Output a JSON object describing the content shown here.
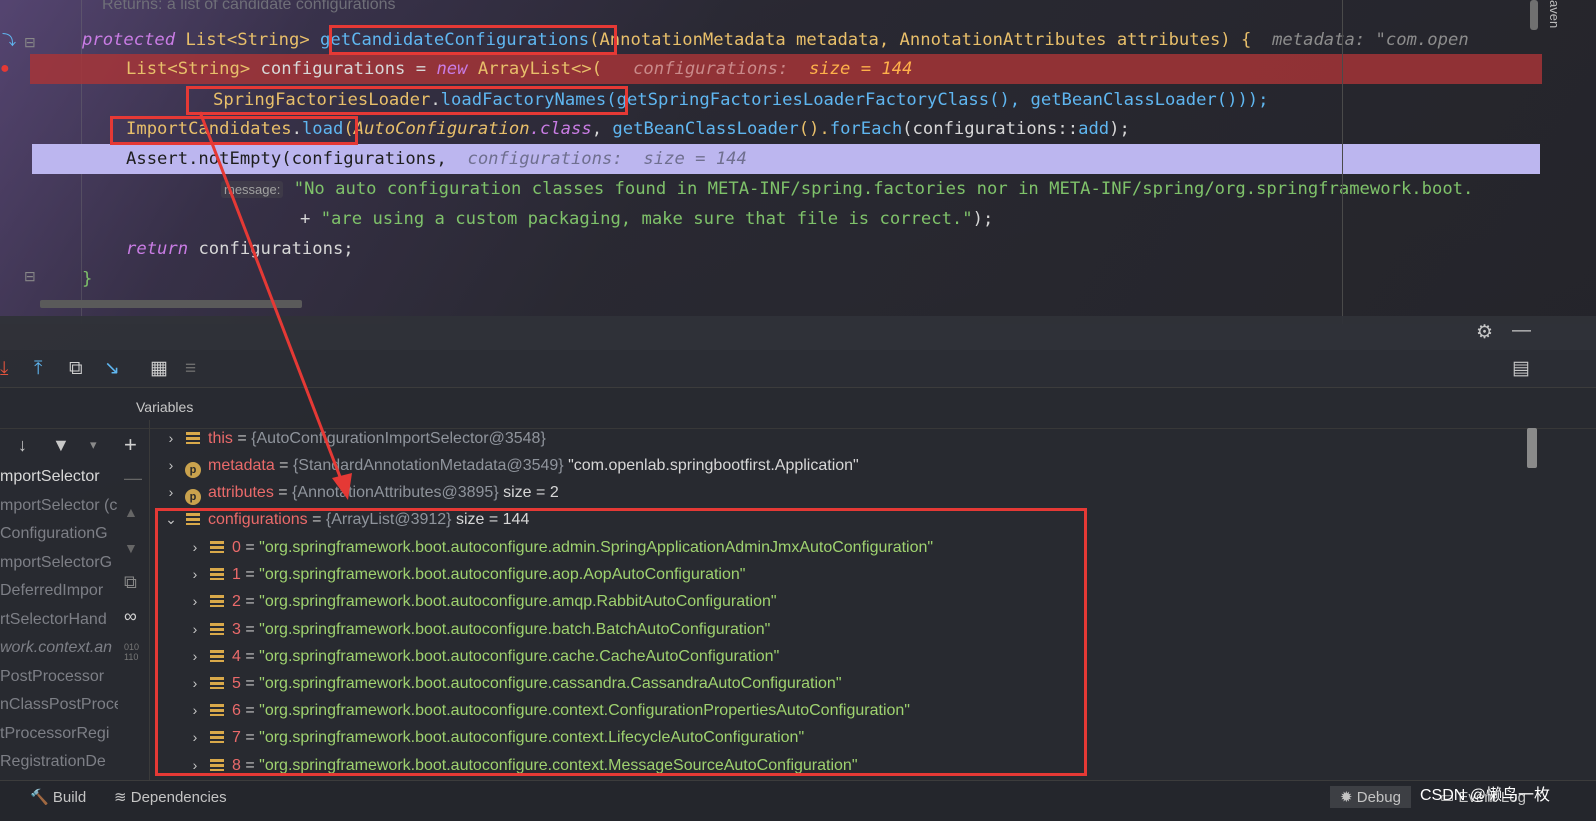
{
  "editor": {
    "doc_comment": "Returns: a list of candidate configurations",
    "lines": [
      {
        "kw": "protected",
        "type": "List<String>",
        "method": "getCandidateConfigurations",
        "params": "(AnnotationMetadata metadata, AnnotationAttributes attributes) {",
        "hint": "metadata: \"com.open"
      },
      {
        "type": "List<String>",
        "name": " configurations = ",
        "kw": "new",
        "ctor": " ArrayList<>(",
        "hint_label": "configurations:",
        "hint_value": "size = 144"
      },
      {
        "cls": "SpringFactoriesLoader",
        "dot": ".",
        "method": "loadFactoryNames",
        "args_a": "(getSpringFactoriesLoaderFactoryClass(), getBeanClassLoader()));"
      },
      {
        "cls": "ImportCandidates",
        "dot": ".",
        "method": "load",
        "open": "(",
        "arg_cls": "AutoConfiguration",
        "arg_kw": ".class",
        "mid": ", ",
        "getcl": "getBeanClassLoader",
        "tail1": "().",
        "foreach": "forEach",
        "tail2": "(configurations::",
        "add": "add",
        "tail3": ");"
      },
      {
        "code": "Assert.notEmpty(configurations,",
        "hint": "configurations:  size = 144"
      },
      {
        "param": "message:",
        "str": "\"No auto configuration classes found in META-INF/spring.factories nor in META-INF/spring/org.springframework.boot."
      },
      {
        "plus": "+ ",
        "str": "\"are using a custom packaging, make sure that file is correct.\"",
        "end": ");"
      },
      {
        "kw": "return",
        "rest": " configurations;"
      },
      {
        "brace": "}"
      }
    ],
    "side_label": "aven"
  },
  "debugger": {
    "variables_title": "Variables",
    "frames": [
      "mportSelector",
      "mportSelector (c",
      "ConfigurationG",
      "mportSelectorG",
      "DeferredImpor",
      "rtSelectorHand",
      "work.context.an",
      "PostProcessor",
      "nClassPostProce",
      "tProcessorRegi",
      "RegistrationDe"
    ],
    "variables": [
      {
        "name": "this",
        "type": "{AutoConfigurationImportSelector@3548}",
        "extra": "",
        "icon": "field-icon"
      },
      {
        "name": "metadata",
        "type": "{StandardAnnotationMetadata@3549}",
        "extra": "\"com.openlab.springbootfirst.Application\"",
        "icon": "param-icon"
      },
      {
        "name": "attributes",
        "type": "{AnnotationAttributes@3895}",
        "extra": "size = 2",
        "icon": "param-icon"
      },
      {
        "name": "configurations",
        "type": "{ArrayList@3912}",
        "extra": "size = 144",
        "icon": "field-icon"
      }
    ],
    "items": [
      {
        "index": "0",
        "value": "\"org.springframework.boot.autoconfigure.admin.SpringApplicationAdminJmxAutoConfiguration\""
      },
      {
        "index": "1",
        "value": "\"org.springframework.boot.autoconfigure.aop.AopAutoConfiguration\""
      },
      {
        "index": "2",
        "value": "\"org.springframework.boot.autoconfigure.amqp.RabbitAutoConfiguration\""
      },
      {
        "index": "3",
        "value": "\"org.springframework.boot.autoconfigure.batch.BatchAutoConfiguration\""
      },
      {
        "index": "4",
        "value": "\"org.springframework.boot.autoconfigure.cache.CacheAutoConfiguration\""
      },
      {
        "index": "5",
        "value": "\"org.springframework.boot.autoconfigure.cassandra.CassandraAutoConfiguration\""
      },
      {
        "index": "6",
        "value": "\"org.springframework.boot.autoconfigure.context.ConfigurationPropertiesAutoConfiguration\""
      },
      {
        "index": "7",
        "value": "\"org.springframework.boot.autoconfigure.context.LifecycleAutoConfiguration\""
      },
      {
        "index": "8",
        "value": "\"org.springframework.boot.autoconfigure.context.MessageSourceAutoConfiguration\""
      }
    ]
  },
  "status_bar": {
    "build": "Build",
    "dependencies": "Dependencies",
    "debug": "Debug",
    "event_log": "Event Log",
    "watermark": "CSDN @懒鸟一枚"
  },
  "colors": {
    "annotation_red": "#e53935",
    "selection": "#bcb6ef",
    "breakpoint_line": "#a83437"
  }
}
